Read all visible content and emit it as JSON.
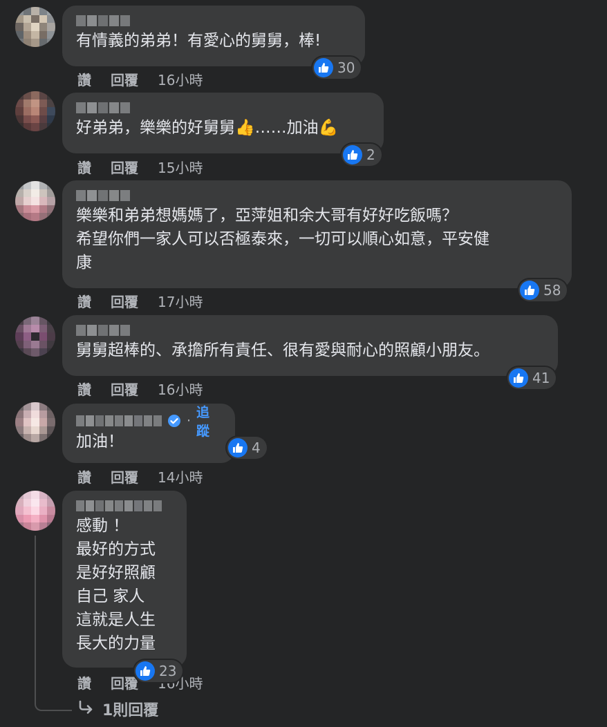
{
  "comments": [
    {
      "text": "有情義的弟弟！有愛心的舅舅，棒!",
      "likes": "30",
      "like": "讚",
      "reply": "回覆",
      "time": "16小時"
    },
    {
      "text": "好弟弟，樂樂的好舅舅👍……加油💪",
      "likes": "2",
      "like": "讚",
      "reply": "回覆",
      "time": "15小時"
    },
    {
      "text": "樂樂和弟弟想媽媽了，亞萍姐和余大哥有好好吃飯嗎？\n希望你們一家人可以否極泰來，一切可以順心如意，平安健\n康",
      "likes": "58",
      "like": "讚",
      "reply": "回覆",
      "time": "17小時"
    },
    {
      "text": "舅舅超棒的、承擔所有責任、很有愛與耐心的照顧小朋友。",
      "likes": "41",
      "like": "讚",
      "reply": "回覆",
      "time": "16小時"
    },
    {
      "text": "加油！",
      "likes": "4",
      "like": "讚",
      "reply": "回覆",
      "time": "14小時",
      "follow": "追蹤",
      "dot": "·"
    },
    {
      "text": "感動 ！\n最好的方式\n是好好照顧\n自己 家人\n這就是人生\n長大的力量",
      "likes": "23",
      "like": "讚",
      "reply": "回覆",
      "time": "16小時"
    }
  ],
  "replies_link": "1則回覆",
  "icons": {
    "like": "thumbs-up-icon",
    "verified": "verified-badge-icon",
    "reply_arrow": "reply-arrow-icon"
  },
  "colors": {
    "background": "#242526",
    "bubble": "#3a3b3c",
    "like_blue": "#1877f2",
    "follow": "#4599ff"
  }
}
